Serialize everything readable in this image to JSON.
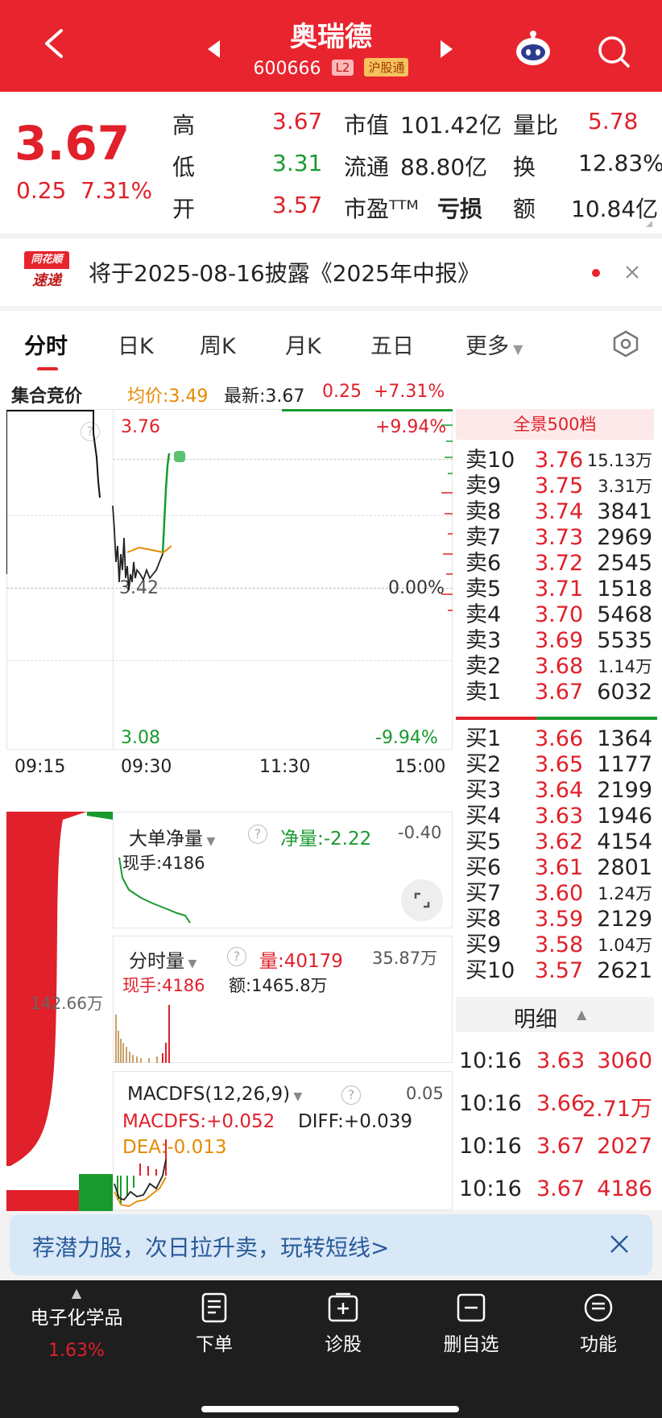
{
  "header": {
    "stock_name": "奥瑞德",
    "code": "600666",
    "badge_l2": "L2",
    "badge_market": "沪股通"
  },
  "quote": {
    "price": "3.67",
    "change": "0.25",
    "change_pct": "7.31%",
    "rows": [
      {
        "l1": "高",
        "v1": "3.67",
        "l2": "市值",
        "v2": "101.42亿",
        "l3": "量比",
        "v3": "5.78"
      },
      {
        "l1": "低",
        "v1": "3.31",
        "l2": "流通",
        "v2": "88.80亿",
        "l3": "换",
        "v3": "12.83%"
      },
      {
        "l1": "开",
        "v1": "3.57",
        "l2": "市盈ᵀᵀᴹ",
        "v2": "亏损",
        "l3": "额",
        "v3": "10.84亿"
      }
    ]
  },
  "notice": {
    "logo_top": "同花顺",
    "logo_bottom": "速递",
    "text": "将于2025-08-16披露《2025年中报》"
  },
  "tabs": [
    "分时",
    "日K",
    "周K",
    "月K",
    "五日",
    "更多"
  ],
  "info_bar": {
    "auction": "集合竞价",
    "avg": "均价:3.49",
    "latest": "最新:3.67",
    "chg": "0.25",
    "pct": "+7.31%"
  },
  "price_chart": {
    "top_price": "3.76",
    "top_pct": "+9.94%",
    "mid_price": "3.42",
    "mid_pct": "0.00%",
    "bottom_price": "3.08",
    "bottom_pct": "-9.94%",
    "times": [
      "09:15",
      "09:30",
      "11:30",
      "15:00"
    ]
  },
  "panels": {
    "big_order": {
      "title": "大单净量",
      "net_label": "净量:-2.22",
      "right": "-0.40",
      "hand": "现手:4186"
    },
    "volume": {
      "title": "分时量",
      "vol_label": "量:40179",
      "right": "35.87万",
      "hand": "现手:4186",
      "amount": "额:1465.8万"
    },
    "macd": {
      "title": "MACDFS(12,26,9)",
      "right": "0.05",
      "macd": "MACDFS:+0.052",
      "diff": "DIFF:+0.039",
      "dea": "DEA:-0.013"
    },
    "left_vol": "142.66万"
  },
  "orderbook": {
    "header": "全景500档",
    "sells": [
      {
        "label": "卖10",
        "price": "3.76",
        "vol": "15.13万"
      },
      {
        "label": "卖9",
        "price": "3.75",
        "vol": "3.31万"
      },
      {
        "label": "卖8",
        "price": "3.74",
        "vol": "3841"
      },
      {
        "label": "卖7",
        "price": "3.73",
        "vol": "2969"
      },
      {
        "label": "卖6",
        "price": "3.72",
        "vol": "2545"
      },
      {
        "label": "卖5",
        "price": "3.71",
        "vol": "1518"
      },
      {
        "label": "卖4",
        "price": "3.70",
        "vol": "5468"
      },
      {
        "label": "卖3",
        "price": "3.69",
        "vol": "5535"
      },
      {
        "label": "卖2",
        "price": "3.68",
        "vol": "1.14万"
      },
      {
        "label": "卖1",
        "price": "3.67",
        "vol": "6032"
      }
    ],
    "buys": [
      {
        "label": "买1",
        "price": "3.66",
        "vol": "1364"
      },
      {
        "label": "买2",
        "price": "3.65",
        "vol": "1177"
      },
      {
        "label": "买3",
        "price": "3.64",
        "vol": "2199"
      },
      {
        "label": "买4",
        "price": "3.63",
        "vol": "1946"
      },
      {
        "label": "买5",
        "price": "3.62",
        "vol": "4154"
      },
      {
        "label": "买6",
        "price": "3.61",
        "vol": "2801"
      },
      {
        "label": "买7",
        "price": "3.60",
        "vol": "1.24万"
      },
      {
        "label": "买8",
        "price": "3.59",
        "vol": "2129"
      },
      {
        "label": "买9",
        "price": "3.58",
        "vol": "1.04万"
      },
      {
        "label": "买10",
        "price": "3.57",
        "vol": "2621"
      }
    ],
    "detail_title": "明细",
    "trades": [
      {
        "time": "10:16",
        "price": "3.63",
        "vol": "3060"
      },
      {
        "time": "10:16",
        "price": "3.66",
        "vol": "2.71万"
      },
      {
        "time": "10:16",
        "price": "3.67",
        "vol": "2027"
      },
      {
        "time": "10:16",
        "price": "3.67",
        "vol": "4186"
      }
    ]
  },
  "promo": {
    "text": "荐潜力股，次日拉升卖，玩转短线>"
  },
  "bottom_nav": {
    "sector": "电子化学品",
    "sector_pct": "1.63%",
    "items": [
      "下单",
      "诊股",
      "删自选",
      "功能"
    ]
  },
  "colors": {
    "header_red": "#e8242e",
    "up_red": "#e0202a",
    "down_green": "#199a2e",
    "avg_orange": "#e68a00"
  }
}
